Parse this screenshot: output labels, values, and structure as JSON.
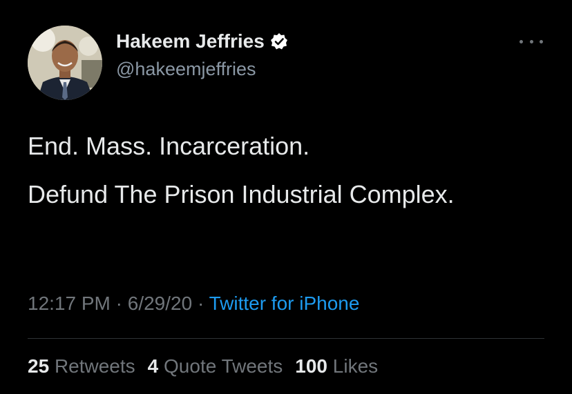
{
  "author": {
    "name": "Hakeem Jeffries",
    "handle": "@hakeemjeffries",
    "verified": true,
    "verified_icon": "verified-badge-icon",
    "avatar_icon": "profile-photo"
  },
  "tweet": {
    "paragraphs": [
      "End. Mass. Incarceration.",
      "Defund The Prison Industrial Complex."
    ],
    "time": "12:17 PM",
    "date": "6/29/20",
    "source": "Twitter for iPhone",
    "separator": "·"
  },
  "stats": [
    {
      "count": "25",
      "label": "Retweets"
    },
    {
      "count": "4",
      "label": "Quote Tweets"
    },
    {
      "count": "100",
      "label": "Likes"
    }
  ],
  "more_icon": "more-options-icon",
  "colors": {
    "background": "#000000",
    "primary_text": "#e7e9ea",
    "secondary_text": "#71767b",
    "link": "#1d9bf0",
    "divider": "#2f3336"
  }
}
